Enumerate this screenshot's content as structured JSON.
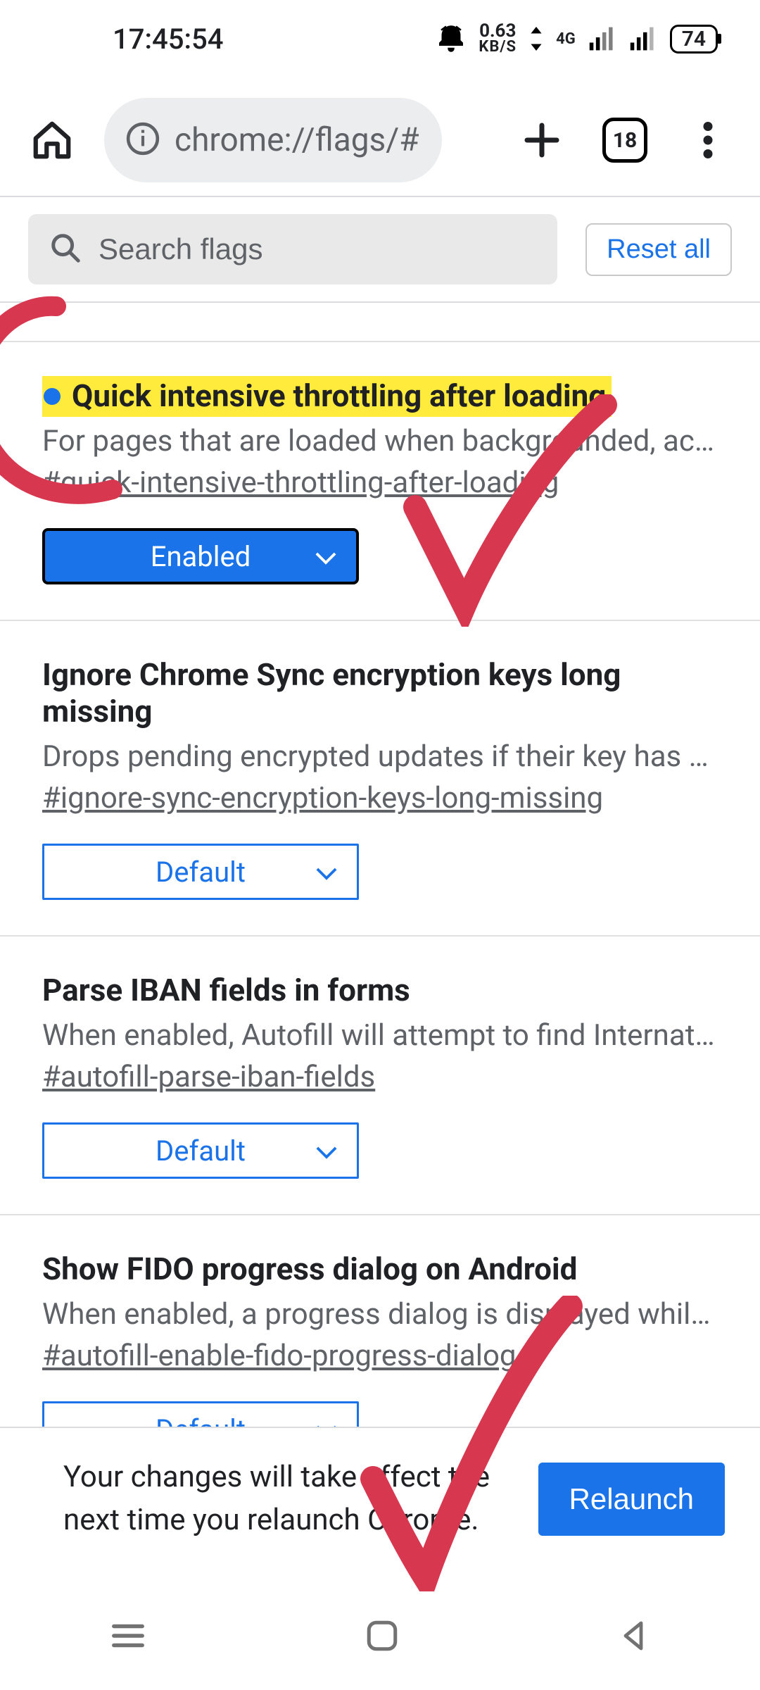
{
  "statusbar": {
    "time": "17:45:54",
    "net_speed": "0.63",
    "net_unit": "KB/S",
    "net_type": "4G",
    "battery": "74"
  },
  "browser": {
    "url": "chrome://flags/#",
    "tab_count": "18"
  },
  "search": {
    "placeholder": "Search flags",
    "reset_label": "Reset all"
  },
  "flags": [
    {
      "title": "Quick intensive throttling after loading",
      "desc": "For pages that are loaded when backgrounded, acti…",
      "anchor": "#quick-intensive-throttling-after-loading",
      "value": "Enabled",
      "modified": true
    },
    {
      "title": "Ignore Chrome Sync encryption keys long missing",
      "desc": "Drops pending encrypted updates if their key has be…",
      "anchor": "#ignore-sync-encryption-keys-long-missing",
      "value": "Default",
      "modified": false
    },
    {
      "title": "Parse IBAN fields in forms",
      "desc": "When enabled, Autofill will attempt to find Internatio…",
      "anchor": "#autofill-parse-iban-fields",
      "value": "Default",
      "modified": false
    },
    {
      "title": "Show FIDO progress dialog on Android",
      "desc": "When enabled, a progress dialog is displayed while …",
      "anchor": "#autofill-enable-fido-progress-dialog",
      "value": "Default",
      "modified": false
    }
  ],
  "relaunch": {
    "msg": "Your changes will take effect the next time you relaunch Chrome.",
    "button": "Relaunch"
  }
}
